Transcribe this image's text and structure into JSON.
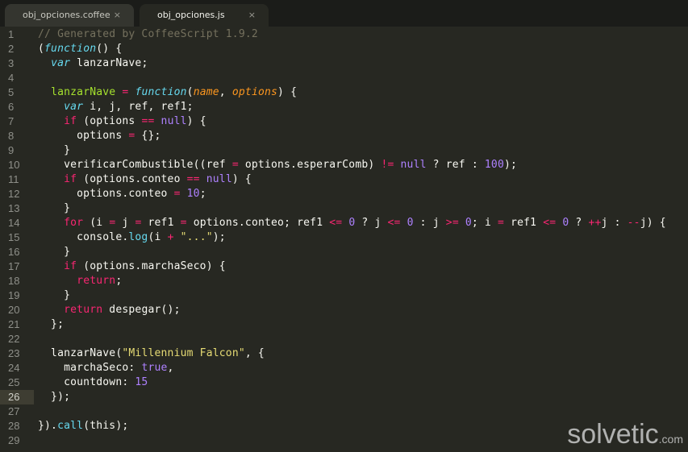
{
  "tabs": [
    {
      "label": "obj_opciones.coffee",
      "active": false,
      "close": "×"
    },
    {
      "label": "obj_opciones.js",
      "active": true,
      "close": "×"
    }
  ],
  "current_line": 26,
  "lines": [
    [
      [
        "c",
        "// Generated by CoffeeScript 1.9.2"
      ]
    ],
    [
      [
        "t",
        "("
      ],
      [
        "s",
        "function"
      ],
      [
        "t",
        "() {"
      ]
    ],
    [
      [
        "t",
        "  "
      ],
      [
        "s",
        "var"
      ],
      [
        "t",
        " lanzarNave;"
      ]
    ],
    [],
    [
      [
        "t",
        "  "
      ],
      [
        "f",
        "lanzarNave"
      ],
      [
        "t",
        " "
      ],
      [
        "k",
        "="
      ],
      [
        "t",
        " "
      ],
      [
        "s",
        "function"
      ],
      [
        "t",
        "("
      ],
      [
        "p",
        "name"
      ],
      [
        "t",
        ", "
      ],
      [
        "p",
        "options"
      ],
      [
        "t",
        ") {"
      ]
    ],
    [
      [
        "t",
        "    "
      ],
      [
        "s",
        "var"
      ],
      [
        "t",
        " i, j, ref, ref1;"
      ]
    ],
    [
      [
        "t",
        "    "
      ],
      [
        "k",
        "if"
      ],
      [
        "t",
        " (options "
      ],
      [
        "k",
        "=="
      ],
      [
        "t",
        " "
      ],
      [
        "n",
        "null"
      ],
      [
        "t",
        ") {"
      ]
    ],
    [
      [
        "t",
        "      options "
      ],
      [
        "k",
        "="
      ],
      [
        "t",
        " {};"
      ]
    ],
    [
      [
        "t",
        "    }"
      ]
    ],
    [
      [
        "t",
        "    verificarCombustible((ref "
      ],
      [
        "k",
        "="
      ],
      [
        "t",
        " options.esperarComb) "
      ],
      [
        "k",
        "!="
      ],
      [
        "t",
        " "
      ],
      [
        "n",
        "null"
      ],
      [
        "t",
        " ? ref : "
      ],
      [
        "n",
        "100"
      ],
      [
        "t",
        ");"
      ]
    ],
    [
      [
        "t",
        "    "
      ],
      [
        "k",
        "if"
      ],
      [
        "t",
        " (options.conteo "
      ],
      [
        "k",
        "=="
      ],
      [
        "t",
        " "
      ],
      [
        "n",
        "null"
      ],
      [
        "t",
        ") {"
      ]
    ],
    [
      [
        "t",
        "      options.conteo "
      ],
      [
        "k",
        "="
      ],
      [
        "t",
        " "
      ],
      [
        "n",
        "10"
      ],
      [
        "t",
        ";"
      ]
    ],
    [
      [
        "t",
        "    }"
      ]
    ],
    [
      [
        "t",
        "    "
      ],
      [
        "k",
        "for"
      ],
      [
        "t",
        " (i "
      ],
      [
        "k",
        "="
      ],
      [
        "t",
        " j "
      ],
      [
        "k",
        "="
      ],
      [
        "t",
        " ref1 "
      ],
      [
        "k",
        "="
      ],
      [
        "t",
        " options.conteo; ref1 "
      ],
      [
        "k",
        "<="
      ],
      [
        "t",
        " "
      ],
      [
        "n",
        "0"
      ],
      [
        "t",
        " ? j "
      ],
      [
        "k",
        "<="
      ],
      [
        "t",
        " "
      ],
      [
        "n",
        "0"
      ],
      [
        "t",
        " : j "
      ],
      [
        "k",
        ">="
      ],
      [
        "t",
        " "
      ],
      [
        "n",
        "0"
      ],
      [
        "t",
        "; i "
      ],
      [
        "k",
        "="
      ],
      [
        "t",
        " ref1 "
      ],
      [
        "k",
        "<="
      ],
      [
        "t",
        " "
      ],
      [
        "n",
        "0"
      ],
      [
        "t",
        " ? "
      ],
      [
        "k",
        "++"
      ],
      [
        "t",
        "j : "
      ],
      [
        "k",
        "--"
      ],
      [
        "t",
        "j) {"
      ]
    ],
    [
      [
        "t",
        "      console."
      ],
      [
        "sup",
        "log"
      ],
      [
        "t",
        "(i "
      ],
      [
        "k",
        "+"
      ],
      [
        "t",
        " "
      ],
      [
        "str",
        "\"...\""
      ],
      [
        "t",
        ");"
      ]
    ],
    [
      [
        "t",
        "    }"
      ]
    ],
    [
      [
        "t",
        "    "
      ],
      [
        "k",
        "if"
      ],
      [
        "t",
        " (options.marchaSeco) {"
      ]
    ],
    [
      [
        "t",
        "      "
      ],
      [
        "k",
        "return"
      ],
      [
        "t",
        ";"
      ]
    ],
    [
      [
        "t",
        "    }"
      ]
    ],
    [
      [
        "t",
        "    "
      ],
      [
        "k",
        "return"
      ],
      [
        "t",
        " despegar();"
      ]
    ],
    [
      [
        "t",
        "  };"
      ]
    ],
    [],
    [
      [
        "t",
        "  lanzarNave("
      ],
      [
        "str",
        "\"Millennium Falcon\""
      ],
      [
        "t",
        ", {"
      ]
    ],
    [
      [
        "t",
        "    marchaSeco: "
      ],
      [
        "n",
        "true"
      ],
      [
        "t",
        ","
      ]
    ],
    [
      [
        "t",
        "    countdown: "
      ],
      [
        "n",
        "15"
      ]
    ],
    [
      [
        "t",
        "  });"
      ]
    ],
    [],
    [
      [
        "t",
        "})."
      ],
      [
        "sup",
        "call"
      ],
      [
        "t",
        "(this);"
      ]
    ],
    []
  ],
  "watermark": {
    "main": "solvetic",
    "domain": ".com"
  }
}
